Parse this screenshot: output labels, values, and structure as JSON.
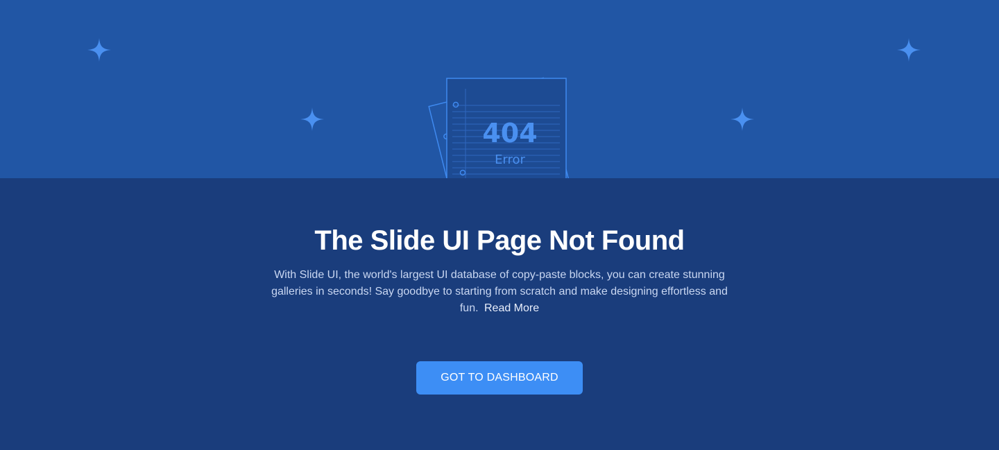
{
  "illustration": {
    "code": "404",
    "label": "Error"
  },
  "main": {
    "title": "The Slide UI Page Not Found",
    "description": "With Slide UI, the world's largest UI database of copy-paste blocks, you can create stunning galleries in seconds! Say goodbye to starting from scratch and make designing effortless and fun.",
    "read_more_label": "Read More",
    "cta_label": "GOT TO DASHBOARD"
  },
  "colors": {
    "hero_top": "#2156a5",
    "page_bg": "#1a3d7c",
    "accent": "#3d8ef5",
    "sparkle": "#4a90f0"
  },
  "icons": [
    "sparkle-icon",
    "sparkle-icon",
    "sparkle-icon",
    "sparkle-icon",
    "paper-stack-icon"
  ]
}
